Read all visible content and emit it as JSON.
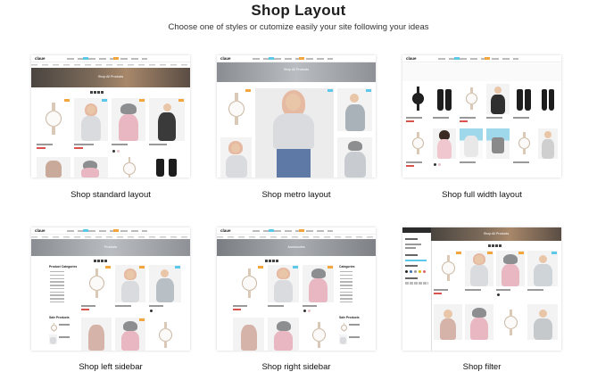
{
  "page": {
    "title": "Shop Layout",
    "subtitle": "Choose one of styles or cutomize easily your site following your ideas"
  },
  "layouts": [
    {
      "label": "Shop standard layout",
      "logo": "claue",
      "hero_text": "Shop All Products"
    },
    {
      "label": "Shop metro layout",
      "logo": "claue",
      "hero_text": "Shop All Products"
    },
    {
      "label": "Shop full width layout",
      "logo": "claue",
      "hero_text": ""
    },
    {
      "label": "Shop left sidebar",
      "logo": "claue",
      "hero_text": "Products"
    },
    {
      "label": "Shop right sidebar",
      "logo": "claue",
      "hero_text": "Accessories"
    },
    {
      "label": "Shop filter",
      "logo": "",
      "hero_text": "Shop All Products"
    }
  ],
  "sidebar": {
    "left_heading": "Product Categories",
    "left_heading2": "Sale Products",
    "right_heading": "Categories",
    "right_heading2": "Sale Products"
  },
  "colors": {
    "accent_blue": "#5ec8ea",
    "accent_orange": "#f2a63d",
    "sale_red": "#d9534f"
  }
}
